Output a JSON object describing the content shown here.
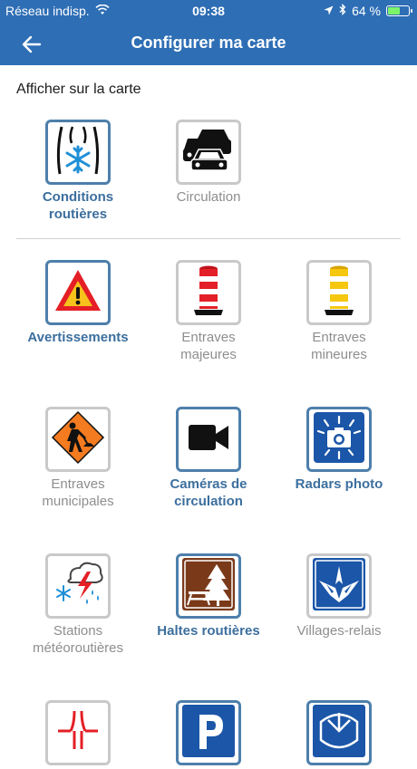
{
  "status_bar": {
    "carrier": "Réseau indisp.",
    "time": "09:38",
    "battery": "64 %",
    "battery_level": 0.64
  },
  "header": {
    "title": "Configurer ma carte"
  },
  "section": {
    "title": "Afficher sur la carte"
  },
  "tiles": [
    {
      "label": "Conditions routières",
      "selected": true,
      "icon": "road-snowflake-icon"
    },
    {
      "label": "Circulation",
      "selected": false,
      "icon": "traffic-cars-icon"
    },
    {
      "label": "Avertissements",
      "selected": true,
      "icon": "warning-triangle-icon"
    },
    {
      "label": "Entraves majeures",
      "selected": false,
      "icon": "red-barrel-icon"
    },
    {
      "label": "Entraves mineures",
      "selected": false,
      "icon": "yellow-barrel-icon"
    },
    {
      "label": "Entraves municipales",
      "selected": false,
      "icon": "roadwork-sign-icon"
    },
    {
      "label": "Caméras de circulation",
      "selected": true,
      "icon": "video-camera-icon"
    },
    {
      "label": "Radars photo",
      "selected": true,
      "icon": "photo-radar-icon"
    },
    {
      "label": "Stations météoroutières",
      "selected": false,
      "icon": "weather-station-icon"
    },
    {
      "label": "Haltes routières",
      "selected": true,
      "icon": "rest-area-icon"
    },
    {
      "label": "Villages-relais",
      "selected": false,
      "icon": "village-relais-icon"
    },
    {
      "label": "",
      "selected": false,
      "icon": "interchange-icon"
    },
    {
      "label": "",
      "selected": true,
      "icon": "parking-icon"
    },
    {
      "label": "",
      "selected": true,
      "icon": "highway-shield-icon"
    }
  ]
}
